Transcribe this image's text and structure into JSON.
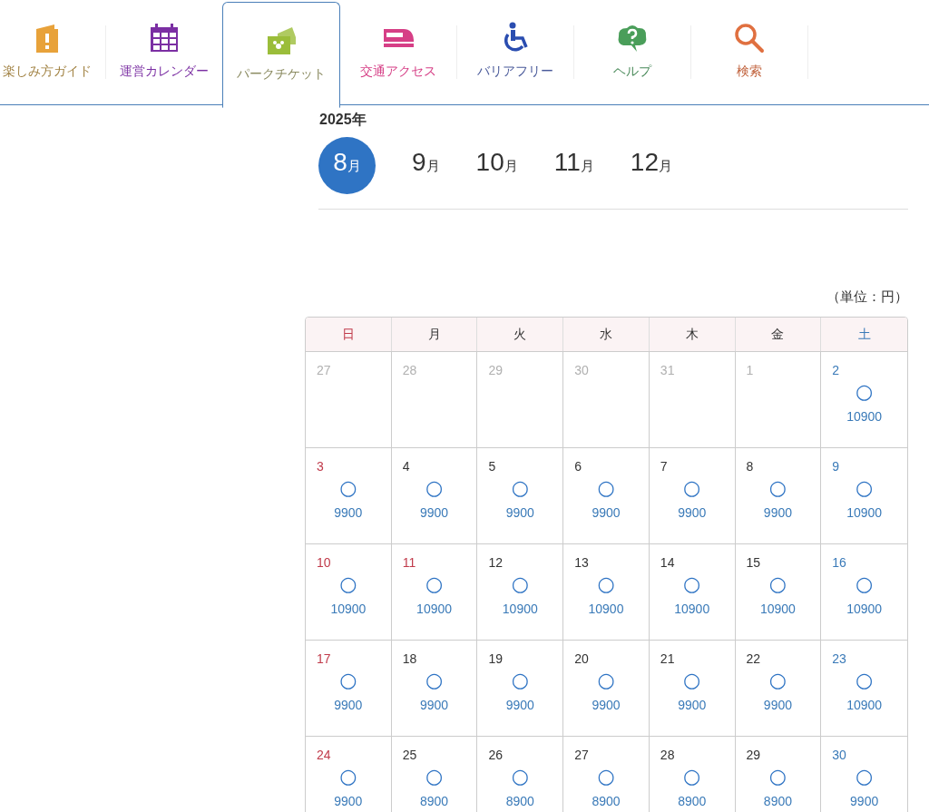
{
  "nav_tabs": [
    {
      "label": "楽しみ方ガイド",
      "selected": false
    },
    {
      "label": "運営カレンダー",
      "selected": false
    },
    {
      "label": "パークチケット",
      "selected": true
    },
    {
      "label": "交通アクセス",
      "selected": false
    },
    {
      "label": "バリアフリー",
      "selected": false
    },
    {
      "label": "ヘルプ",
      "selected": false
    },
    {
      "label": "検索",
      "selected": false
    }
  ],
  "year": "2025年",
  "months": [
    {
      "number": "8",
      "unit": "月",
      "selected": true
    },
    {
      "number": "9",
      "unit": "月",
      "selected": false
    },
    {
      "number": "10",
      "unit": "月",
      "selected": false
    },
    {
      "number": "11",
      "unit": "月",
      "selected": false
    },
    {
      "number": "12",
      "unit": "月",
      "selected": false
    }
  ],
  "unit_note": "（単位：円）",
  "weekdays": [
    {
      "label": "日",
      "kind": "sun"
    },
    {
      "label": "月",
      "kind": "weekday"
    },
    {
      "label": "火",
      "kind": "weekday"
    },
    {
      "label": "水",
      "kind": "weekday"
    },
    {
      "label": "木",
      "kind": "weekday"
    },
    {
      "label": "金",
      "kind": "weekday"
    },
    {
      "label": "土",
      "kind": "sat"
    }
  ],
  "weeks": [
    [
      {
        "day": "27",
        "kind": "other"
      },
      {
        "day": "28",
        "kind": "other"
      },
      {
        "day": "29",
        "kind": "other"
      },
      {
        "day": "30",
        "kind": "other"
      },
      {
        "day": "31",
        "kind": "other"
      },
      {
        "day": "1",
        "kind": "other"
      },
      {
        "day": "2",
        "kind": "sat",
        "mark": "○",
        "price": "10900"
      }
    ],
    [
      {
        "day": "3",
        "kind": "sun",
        "mark": "○",
        "price": "9900"
      },
      {
        "day": "4",
        "kind": "weekday",
        "mark": "○",
        "price": "9900"
      },
      {
        "day": "5",
        "kind": "weekday",
        "mark": "○",
        "price": "9900"
      },
      {
        "day": "6",
        "kind": "weekday",
        "mark": "○",
        "price": "9900"
      },
      {
        "day": "7",
        "kind": "weekday",
        "mark": "○",
        "price": "9900"
      },
      {
        "day": "8",
        "kind": "weekday",
        "mark": "○",
        "price": "9900"
      },
      {
        "day": "9",
        "kind": "sat",
        "mark": "○",
        "price": "10900"
      }
    ],
    [
      {
        "day": "10",
        "kind": "sun",
        "mark": "○",
        "price": "10900"
      },
      {
        "day": "11",
        "kind": "holiday",
        "mark": "○",
        "price": "10900"
      },
      {
        "day": "12",
        "kind": "weekday",
        "mark": "○",
        "price": "10900"
      },
      {
        "day": "13",
        "kind": "weekday",
        "mark": "○",
        "price": "10900"
      },
      {
        "day": "14",
        "kind": "weekday",
        "mark": "○",
        "price": "10900"
      },
      {
        "day": "15",
        "kind": "weekday",
        "mark": "○",
        "price": "10900"
      },
      {
        "day": "16",
        "kind": "sat",
        "mark": "○",
        "price": "10900"
      }
    ],
    [
      {
        "day": "17",
        "kind": "sun",
        "mark": "○",
        "price": "9900"
      },
      {
        "day": "18",
        "kind": "weekday",
        "mark": "○",
        "price": "9900"
      },
      {
        "day": "19",
        "kind": "weekday",
        "mark": "○",
        "price": "9900"
      },
      {
        "day": "20",
        "kind": "weekday",
        "mark": "○",
        "price": "9900"
      },
      {
        "day": "21",
        "kind": "weekday",
        "mark": "○",
        "price": "9900"
      },
      {
        "day": "22",
        "kind": "weekday",
        "mark": "○",
        "price": "9900"
      },
      {
        "day": "23",
        "kind": "sat",
        "mark": "○",
        "price": "10900"
      }
    ],
    [
      {
        "day": "24",
        "kind": "sun",
        "mark": "○",
        "price": "9900"
      },
      {
        "day": "25",
        "kind": "weekday",
        "mark": "○",
        "price": "8900"
      },
      {
        "day": "26",
        "kind": "weekday",
        "mark": "○",
        "price": "8900"
      },
      {
        "day": "27",
        "kind": "weekday",
        "mark": "○",
        "price": "8900"
      },
      {
        "day": "28",
        "kind": "weekday",
        "mark": "○",
        "price": "8900"
      },
      {
        "day": "29",
        "kind": "weekday",
        "mark": "○",
        "price": "8900"
      },
      {
        "day": "30",
        "kind": "sat",
        "mark": "○",
        "price": "9900"
      }
    ]
  ]
}
